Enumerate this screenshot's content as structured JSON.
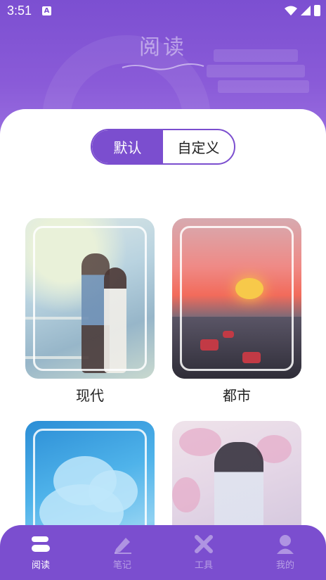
{
  "status_bar": {
    "time": "3:51",
    "notification_icon": "A"
  },
  "header": {
    "title": "阅读"
  },
  "segmented": {
    "options": [
      "默认",
      "自定义"
    ],
    "selected": 0
  },
  "categories": [
    {
      "label": "现代"
    },
    {
      "label": "都市"
    },
    {
      "label": ""
    },
    {
      "label": ""
    }
  ],
  "tab_bar": {
    "items": [
      {
        "label": "阅读",
        "icon": "book-icon",
        "active": true
      },
      {
        "label": "笔记",
        "icon": "pen-icon",
        "active": false
      },
      {
        "label": "工具",
        "icon": "tools-icon",
        "active": false
      },
      {
        "label": "我的",
        "icon": "user-icon",
        "active": false
      }
    ]
  },
  "colors": {
    "accent": "#7b4ecf",
    "header": "#8a5bd8"
  }
}
